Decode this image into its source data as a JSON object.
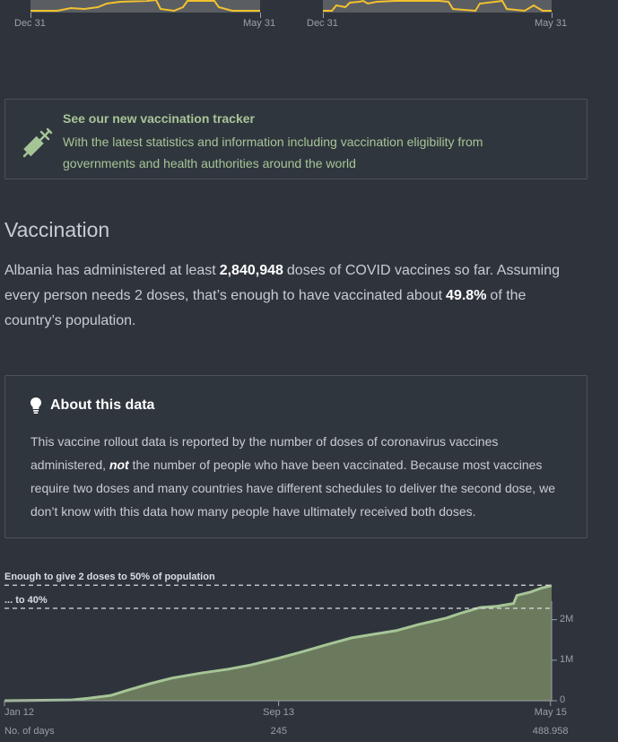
{
  "top_charts": {
    "left": {
      "start_label": "Dec 31",
      "end_label": "May 31"
    },
    "right": {
      "start_label": "Dec 31",
      "end_label": "May 31"
    },
    "line_color": "#f2c12e"
  },
  "tracker": {
    "title": "See our new vaccination tracker",
    "description": "With the latest statistics and information including vaccination eligibility from governments and health authorities around the world",
    "icon": "syringe-icon",
    "accent": "#a6c597"
  },
  "vaccination": {
    "heading": "Vaccination",
    "text_before": "Albania has administered at least",
    "doses": "2,840,948",
    "text_middle": "doses of COVID vaccines so far. Assuming every person needs 2 doses, that’s enough to have vaccinated about",
    "percent": "49.8%",
    "text_after": "of the country’s population."
  },
  "about": {
    "icon": "lightbulb-icon",
    "title": "About this data",
    "text_1": "This vaccine rollout data is reported by the number of doses of coronavirus vaccines administered,",
    "emphasis": "not",
    "text_2": "the number of people who have been vaccinated. Because most vaccines require two doses and many countries have different schedules to deliver the second dose, we don’t know with this data how many people have ultimately received both doses."
  },
  "chart_data": {
    "type": "area",
    "fill": "#6b7a5c",
    "line": "#a6c597",
    "reference_lines": [
      {
        "label": "Enough to give 2 doses to 50% of population",
        "value": 2850000
      },
      {
        "label": "... to 40%",
        "value": 2280000
      }
    ],
    "x_ticks": [
      {
        "label": "Jan 12",
        "day": 0,
        "sub": ""
      },
      {
        "label": "Sep 13",
        "day": 245,
        "sub": "245"
      },
      {
        "label": "May 15",
        "day": 488,
        "sub": "488.958"
      }
    ],
    "x_caption": "No. of days",
    "y_ticks": [
      {
        "label": "0",
        "value": 0
      },
      {
        "label": "1M",
        "value": 1000000
      },
      {
        "label": "2M",
        "value": 2000000
      }
    ],
    "ylim": [
      0,
      2900000
    ],
    "xlim": [
      0,
      489
    ],
    "points": [
      [
        0,
        0
      ],
      [
        60,
        20000
      ],
      [
        75,
        60000
      ],
      [
        95,
        130000
      ],
      [
        110,
        260000
      ],
      [
        130,
        420000
      ],
      [
        150,
        560000
      ],
      [
        175,
        680000
      ],
      [
        200,
        780000
      ],
      [
        220,
        880000
      ],
      [
        245,
        1050000
      ],
      [
        265,
        1200000
      ],
      [
        290,
        1400000
      ],
      [
        310,
        1550000
      ],
      [
        330,
        1640000
      ],
      [
        350,
        1730000
      ],
      [
        370,
        1880000
      ],
      [
        395,
        2040000
      ],
      [
        410,
        2180000
      ],
      [
        425,
        2300000
      ],
      [
        440,
        2330000
      ],
      [
        455,
        2400000
      ],
      [
        458,
        2600000
      ],
      [
        470,
        2680000
      ],
      [
        480,
        2780000
      ],
      [
        489,
        2840948
      ]
    ]
  }
}
